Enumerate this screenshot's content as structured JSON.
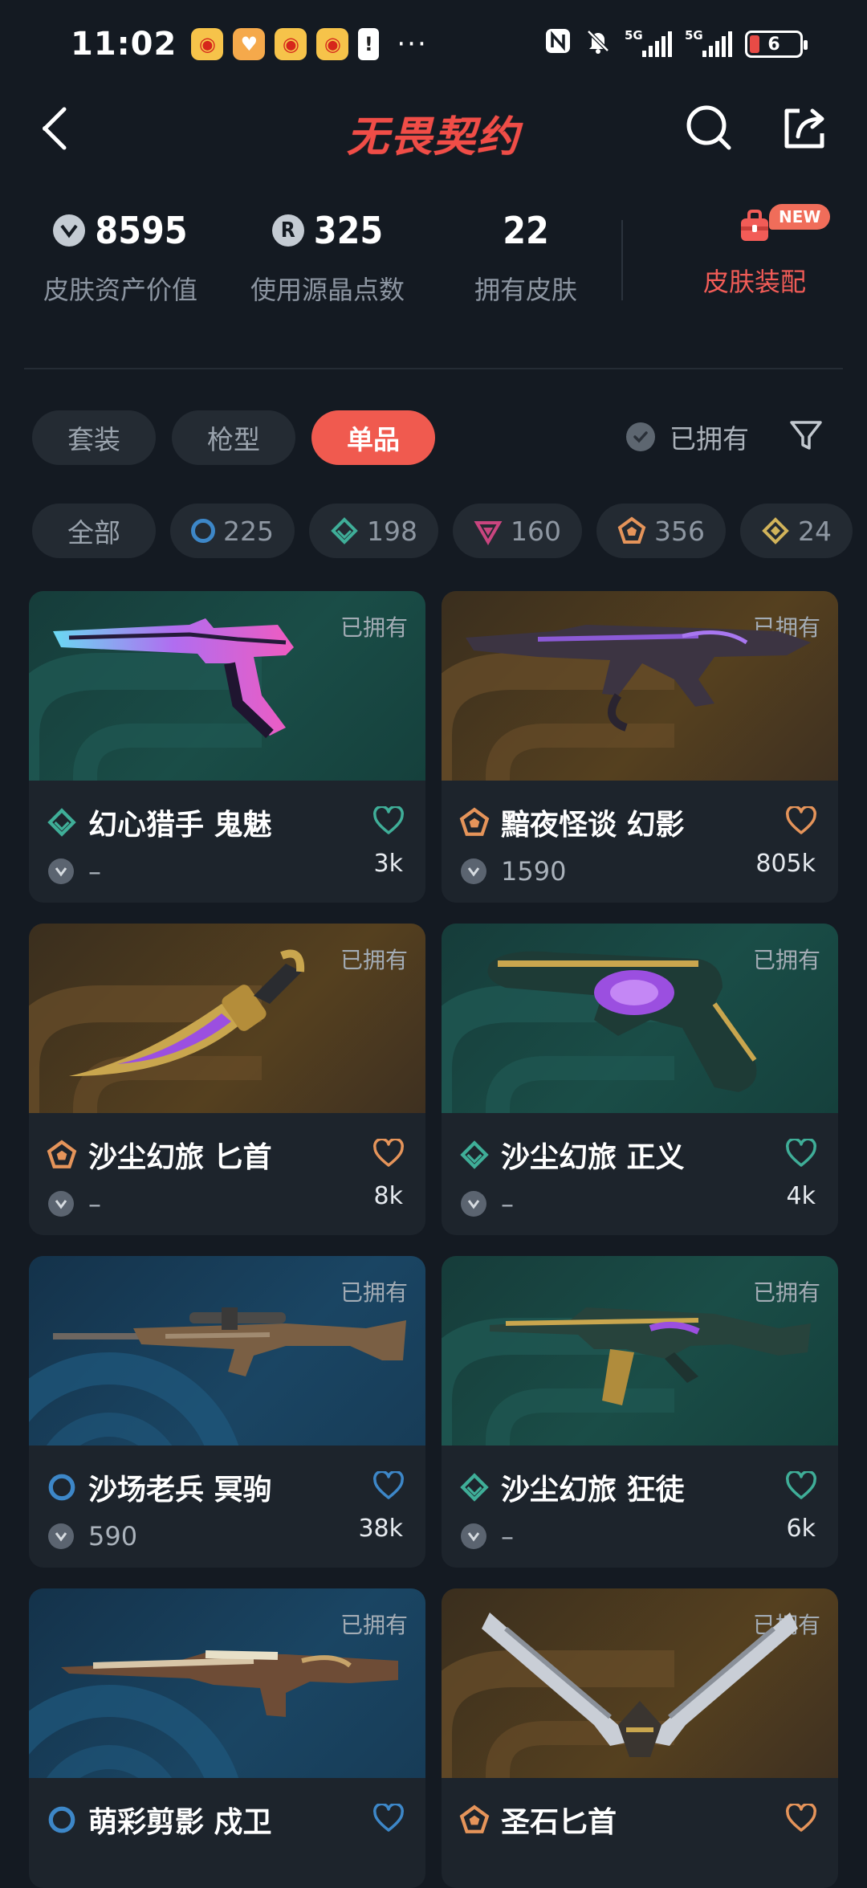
{
  "status_bar": {
    "time": "11:02",
    "more": "···",
    "battery": "6",
    "net_1": "5G",
    "net_2": "5G"
  },
  "header": {
    "title": "无畏契约"
  },
  "stats": {
    "asset_value": "8595",
    "asset_value_label": "皮肤资产价值",
    "radianite": "325",
    "radianite_icon_letter": "R",
    "radianite_label": "使用源晶点数",
    "owned_count": "22",
    "owned_count_label": "拥有皮肤",
    "outfit_label": "皮肤装配",
    "outfit_badge": "NEW"
  },
  "tabs": [
    "套装",
    "枪型",
    "单品"
  ],
  "active_tab": "单品",
  "owned_filter_label": "已拥有",
  "rarity_chips": [
    {
      "label": "全部"
    },
    {
      "icon": "select-tier-icon",
      "count": "225"
    },
    {
      "icon": "deluxe-tier-icon",
      "count": "198"
    },
    {
      "icon": "premium-tier-icon",
      "count": "160"
    },
    {
      "icon": "exclusive-tier-icon",
      "count": "356"
    },
    {
      "icon": "ultra-tier-icon",
      "count": "24"
    }
  ],
  "cards": [
    {
      "owned": "已拥有",
      "name": "幻心猎手 鬼魅",
      "tier": "deluxe",
      "price": "–",
      "likes": "3k",
      "art": "green",
      "weapon": "ghost-pistol"
    },
    {
      "owned": "已拥有",
      "name": "黯夜怪谈 幻影",
      "tier": "exclusive",
      "price": "1590",
      "likes": "805k",
      "art": "gold",
      "weapon": "phantom-rifle"
    },
    {
      "owned": "已拥有",
      "name": "沙尘幻旅 匕首",
      "tier": "exclusive",
      "price": "–",
      "likes": "8k",
      "art": "gold",
      "weapon": "dagger"
    },
    {
      "owned": "已拥有",
      "name": "沙尘幻旅 正义",
      "tier": "deluxe",
      "price": "–",
      "likes": "4k",
      "art": "green",
      "weapon": "sheriff-revolver"
    },
    {
      "owned": "已拥有",
      "name": "沙场老兵 冥驹",
      "tier": "select",
      "price": "590",
      "likes": "38k",
      "art": "blue",
      "weapon": "sniper"
    },
    {
      "owned": "已拥有",
      "name": "沙尘幻旅 狂徒",
      "tier": "deluxe",
      "price": "–",
      "likes": "6k",
      "art": "green",
      "weapon": "vandal-rifle"
    },
    {
      "owned": "已拥有",
      "name": "萌彩剪影 戍卫",
      "tier": "select",
      "price": "",
      "likes": "",
      "art": "blue",
      "weapon": "guardian-rifle"
    },
    {
      "owned": "已拥有",
      "name": "圣石匕首",
      "tier": "exclusive",
      "price": "",
      "likes": "",
      "art": "gold",
      "weapon": "winged-blade"
    }
  ],
  "colors": {
    "accent": "#f05a4f",
    "background": "#141a22",
    "select_tier": "#3d87c8",
    "deluxe_tier": "#3fae98",
    "premium_tier": "#c9457f",
    "exclusive_tier": "#e5945a",
    "ultra_tier": "#d1b35a"
  }
}
